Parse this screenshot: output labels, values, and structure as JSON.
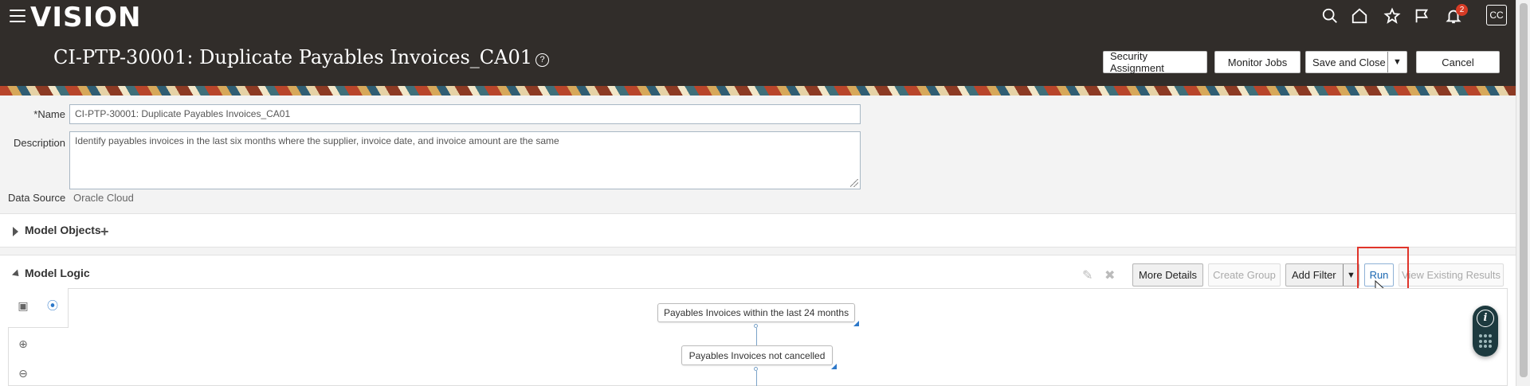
{
  "header": {
    "logo": "VISION",
    "title": "CI-PTP-30001: Duplicate Payables Invoices_CA01",
    "help_glyph": "?",
    "notification_count": "2",
    "avatar_initials": "CC",
    "icons": [
      "menu-icon",
      "search-icon",
      "home-icon",
      "star-icon",
      "flag-icon",
      "bell-icon"
    ],
    "buttons": {
      "security": "Security Assignment",
      "monitor": "Monitor Jobs",
      "save_close": "Save and Close",
      "cancel": "Cancel"
    }
  },
  "form": {
    "name_required": "*",
    "name_label": "Name",
    "name_value": "CI-PTP-30001: Duplicate Payables Invoices_CA01",
    "description_label": "Description",
    "description_value": "Identify payables invoices in the last six months where the supplier, invoice date, and invoice amount are the same",
    "data_source_label": "Data Source",
    "data_source_value": "Oracle Cloud"
  },
  "model_objects": {
    "title": "Model Objects",
    "add_glyph": "+"
  },
  "model_logic": {
    "title": "Model Logic",
    "buttons": {
      "more_details": "More Details",
      "create_group": "Create Group",
      "add_filter": "Add Filter",
      "run": "Run",
      "view_results": "View Existing Results"
    },
    "nodes": [
      {
        "label": "Payables Invoices within the last 24 months"
      },
      {
        "label": "Payables Invoices not cancelled"
      }
    ]
  },
  "colors": {
    "header_bg": "#312d2a",
    "highlight_box": "#e0342a",
    "run_text": "#1a66b1",
    "badge": "#d63b25"
  }
}
